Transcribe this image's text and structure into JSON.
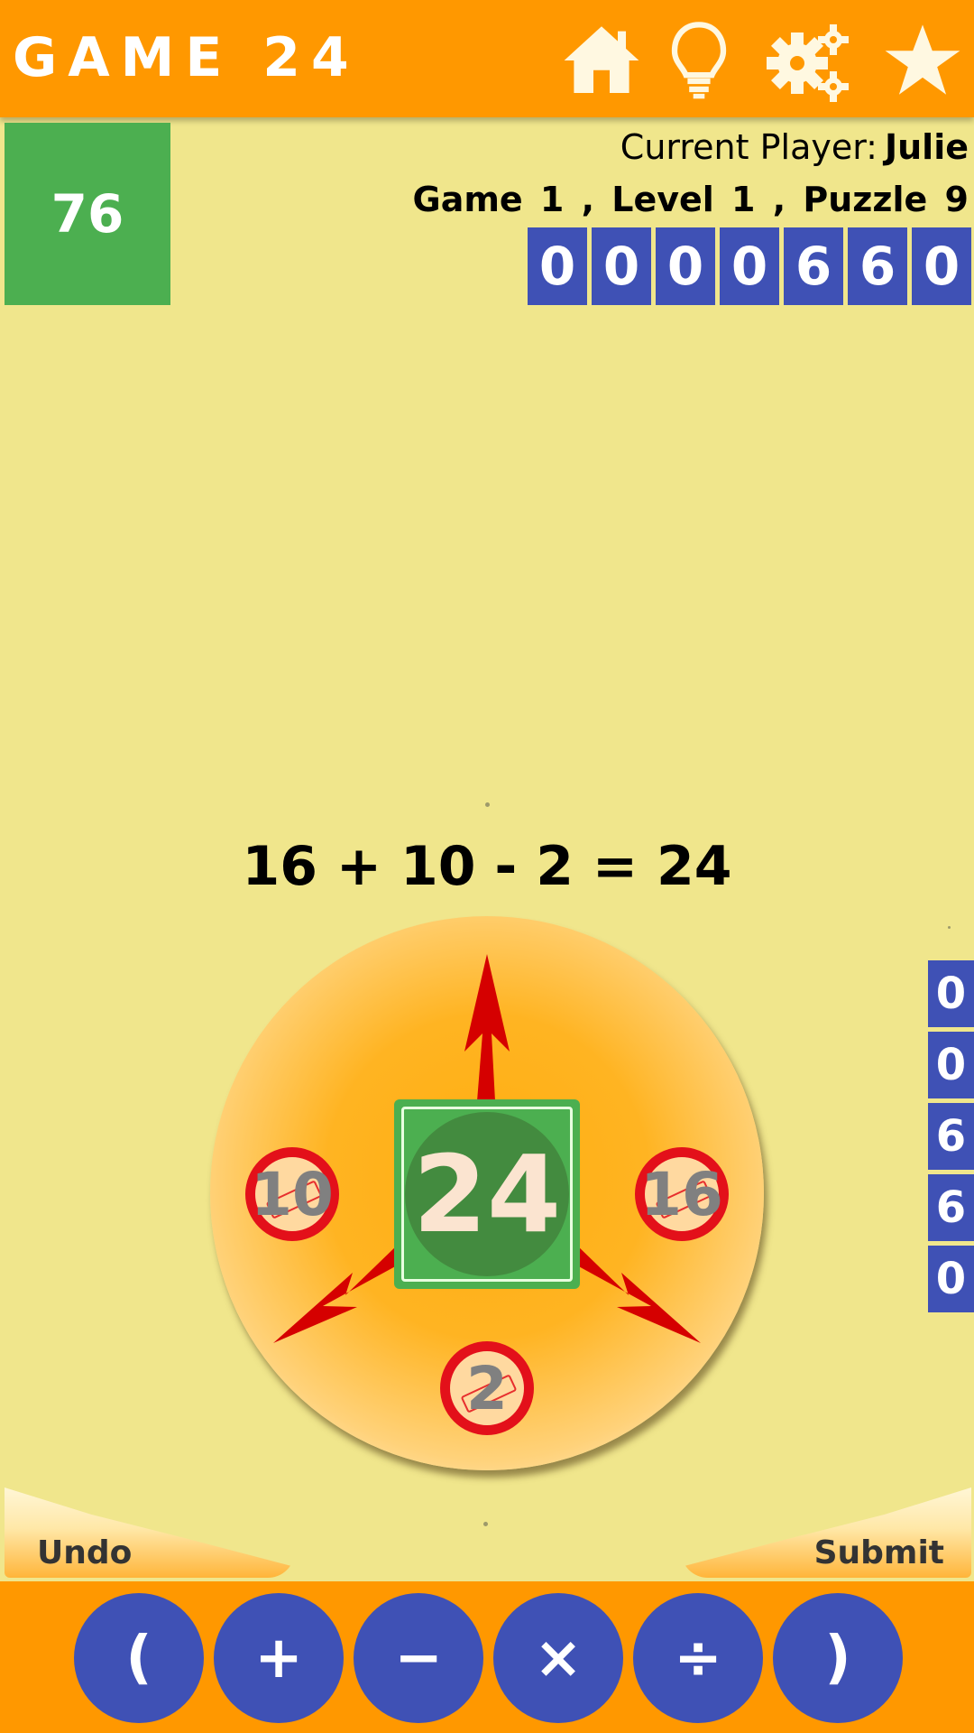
{
  "header": {
    "title": "GAME 24",
    "icons": [
      "home-icon",
      "lightbulb-icon",
      "settings-gears-icon",
      "star-icon"
    ],
    "colors": {
      "bar": "#ff9800",
      "icon": "#fff8e1"
    }
  },
  "status": {
    "timer": "76",
    "player_label": "Current Player:",
    "player_name": "Julie",
    "game_line": "Game 1 , Level 1 , Puzzle 9",
    "score_digits": [
      "0",
      "0",
      "0",
      "0",
      "6",
      "6",
      "0"
    ],
    "side_digits": [
      "0",
      "0",
      "6",
      "6",
      "0"
    ]
  },
  "puzzle": {
    "equation": "16 + 10 - 2 = 24",
    "center_value": "24",
    "numbers": {
      "left": "10",
      "right": "16",
      "bottom": "2"
    }
  },
  "actions": {
    "undo": "Undo",
    "submit": "Submit"
  },
  "operators": {
    "open_paren": "(",
    "plus": "+",
    "minus": "−",
    "times": "×",
    "divide": "÷",
    "close_paren": ")"
  },
  "colors": {
    "background": "#f0e68c",
    "accent_orange": "#ff9800",
    "digit_blue": "#3f51b5",
    "timer_green": "#4caf50",
    "arrow_red": "#d50000"
  }
}
